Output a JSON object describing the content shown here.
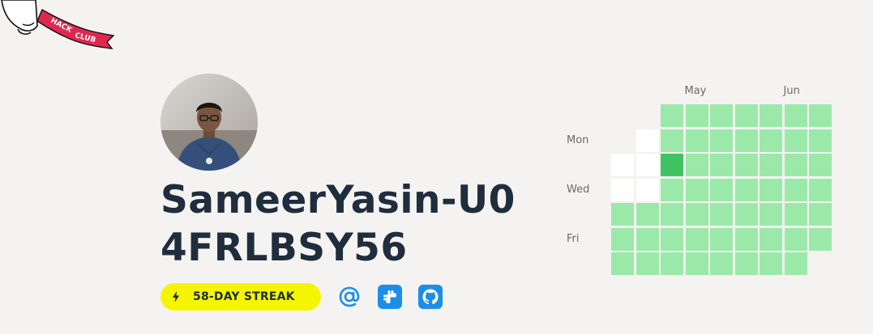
{
  "brand": {
    "flag_text": "HACK CLUB",
    "flag_color": "#e0284f"
  },
  "profile": {
    "username": "SameerYasin-U04FRLBSY56",
    "avatar_alt": "avatar"
  },
  "streak": {
    "label": "58-DAY STREAK",
    "badge_color": "#f5f500"
  },
  "links": [
    {
      "name": "email",
      "icon": "at-icon"
    },
    {
      "name": "slack",
      "icon": "slack-icon"
    },
    {
      "name": "github",
      "icon": "github-icon"
    }
  ],
  "heatmap": {
    "months": [
      {
        "label": "May",
        "col": 3
      },
      {
        "label": "Jun",
        "col": 7
      }
    ],
    "day_labels": [
      {
        "label": "Mon",
        "row": 2
      },
      {
        "label": "Wed",
        "row": 4
      },
      {
        "label": "Fri",
        "row": 6
      }
    ],
    "colors": {
      "empty": "#ffffff",
      "light": "#9be9a8",
      "strong": "#40c463"
    },
    "weeks": [
      [
        "none",
        "none",
        "empty",
        "empty",
        "light",
        "light",
        "light"
      ],
      [
        "none",
        "empty",
        "empty",
        "empty",
        "light",
        "light",
        "light"
      ],
      [
        "light",
        "light",
        "strong",
        "light",
        "light",
        "light",
        "light"
      ],
      [
        "light",
        "light",
        "light",
        "light",
        "light",
        "light",
        "light"
      ],
      [
        "light",
        "light",
        "light",
        "light",
        "light",
        "light",
        "light"
      ],
      [
        "light",
        "light",
        "light",
        "light",
        "light",
        "light",
        "light"
      ],
      [
        "light",
        "light",
        "light",
        "light",
        "light",
        "light",
        "light"
      ],
      [
        "light",
        "light",
        "light",
        "light",
        "light",
        "light",
        "light"
      ],
      [
        "light",
        "light",
        "light",
        "light",
        "light",
        "light",
        "none"
      ]
    ]
  }
}
